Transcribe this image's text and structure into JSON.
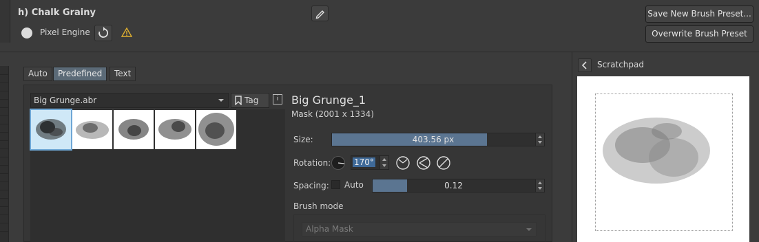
{
  "header": {
    "preset_name": "h) Chalk Grainy",
    "engine_label": "Pixel Engine",
    "save_new_label": "Save New Brush Preset...",
    "overwrite_label": "Overwrite Brush Preset"
  },
  "tabs": [
    {
      "label": "Auto",
      "active": false
    },
    {
      "label": "Predefined",
      "active": true
    },
    {
      "label": "Text",
      "active": false
    }
  ],
  "brush_library": {
    "selected_file": "Big Grunge.abr",
    "tag_label": "Tag",
    "info_label": "i"
  },
  "brush_details": {
    "name": "Big Grunge_1",
    "mask_info": "Mask (2001 x 1334)"
  },
  "size": {
    "label": "Size:",
    "value": "403.56 px",
    "fill_fraction": 0.73
  },
  "rotation": {
    "label": "Rotation:",
    "value": "170°"
  },
  "spacing": {
    "label": "Spacing:",
    "auto_label": "Auto",
    "value": "0.12",
    "fill_fraction": 0.2
  },
  "brush_mode": {
    "label": "Brush mode",
    "selected": "Alpha Mask"
  },
  "scratchpad": {
    "title": "Scratchpad"
  },
  "colors": {
    "accent": "#5b7591",
    "panel": "#3b3b3b",
    "selection": "#3f6a99"
  }
}
